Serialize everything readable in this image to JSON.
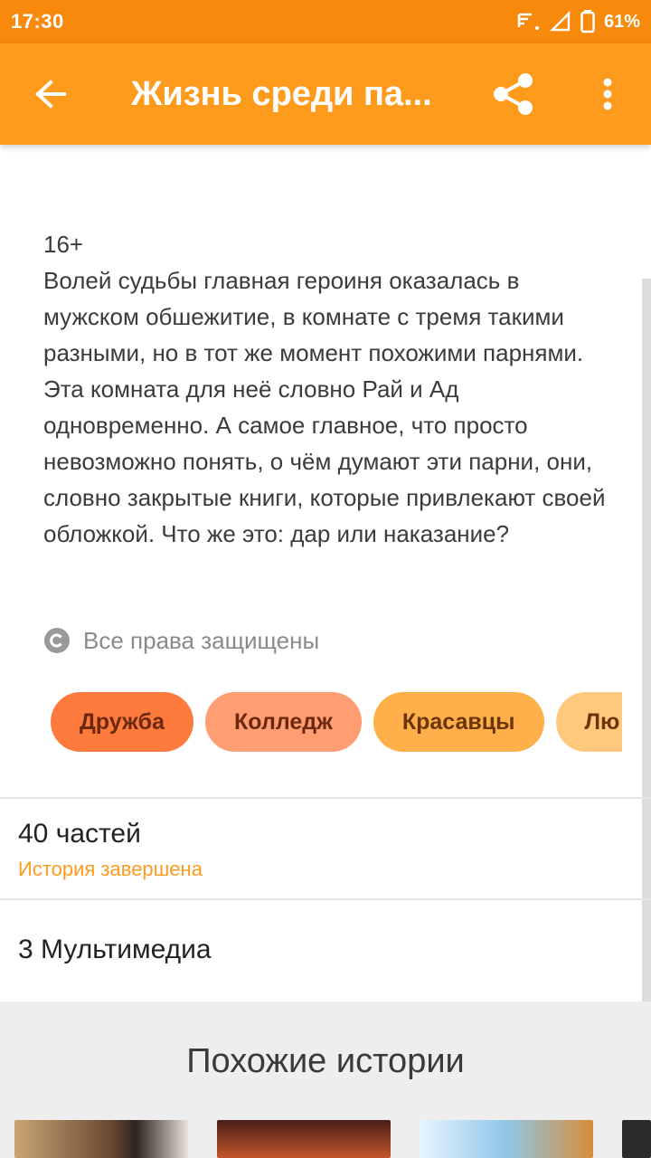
{
  "status_bar": {
    "time": "17:30",
    "battery": "61%"
  },
  "app_bar": {
    "title": "Жизнь среди па...",
    "back_icon": "arrow-back-icon",
    "share_icon": "share-icon",
    "more_icon": "more-vert-icon"
  },
  "description": {
    "age_rating": "16+",
    "text": "Волей судьбы главная героиня оказалась в мужском обшежитие, в комнате с тремя такими разными, но в тот же момент похожими парнями. Эта комната для неё словно Рай и Ад одновременно. А самое главное, что просто невозможно понять, о чём думают эти парни, они, словно закрытые книги, которые привлекают своей обложкой. Что же это: дар или наказание?"
  },
  "copyright": {
    "icon": "copyright-icon",
    "label": "Все права защищены"
  },
  "tags": [
    {
      "label": "Дружба",
      "bg": "#ff7a3d",
      "color": "#6b2a0e"
    },
    {
      "label": "Колледж",
      "bg": "#ff9e72",
      "color": "#6b2a0e"
    },
    {
      "label": "Красавцы",
      "bg": "#ffb04a",
      "color": "#6b3508"
    },
    {
      "label": "Лю",
      "bg": "#ffc97d",
      "color": "#6b3508"
    }
  ],
  "parts": {
    "count": "40 частей",
    "status": "История завершена"
  },
  "multimedia": {
    "label": "3 Мультимедиа"
  },
  "similar": {
    "title": "Похожие истории"
  },
  "colors": {
    "status_bar": "#f7890d",
    "app_bar": "#fe9a1c",
    "accent": "#ff9b1f"
  }
}
